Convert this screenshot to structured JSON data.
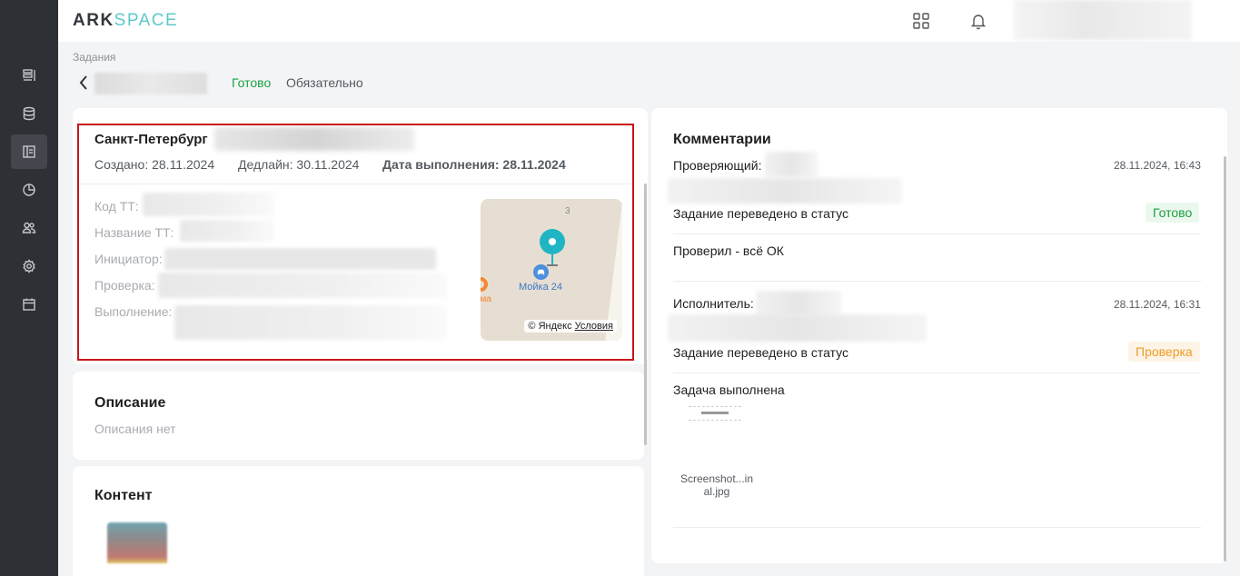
{
  "app": {
    "logo_ark": "ARK",
    "logo_space": "SPACE"
  },
  "sidebar": {
    "items": [
      {
        "icon": "list-icon",
        "active": false
      },
      {
        "icon": "database-icon",
        "active": false
      },
      {
        "icon": "tasks-icon",
        "active": true
      },
      {
        "icon": "chart-pie-icon",
        "active": false
      },
      {
        "icon": "users-icon",
        "active": false
      },
      {
        "icon": "gear-icon",
        "active": false
      },
      {
        "icon": "calendar-icon",
        "active": false
      }
    ]
  },
  "header": {
    "breadcrumb": "Задания",
    "status": "Готово",
    "priority": "Обязательно"
  },
  "task": {
    "city": "Санкт-Петербург",
    "created": "Создано: 28.11.2024",
    "deadline": "Дедлайн: 30.11.2024",
    "completed": "Дата выполнения: 28.11.2024",
    "fields": {
      "code": "Код ТТ:",
      "name": "Название ТТ:",
      "initiator": "Инициатор:",
      "check": "Проверка:",
      "execution": "Выполнение:"
    },
    "map": {
      "building_number": "3",
      "poi_label": "Мойка 24",
      "poi_orange_label": "ома",
      "credit": "© Яндекс",
      "terms": "Условия"
    }
  },
  "description": {
    "title": "Описание",
    "empty": "Описания нет"
  },
  "content": {
    "title": "Контент"
  },
  "comments": {
    "title": "Комментарии",
    "items": [
      {
        "author_label": "Проверяющий:",
        "date": "28.11.2024, 16:43",
        "status_text": "Задание переведено в статус",
        "status_badge": "Готово",
        "message": "Проверил - всё ОК"
      },
      {
        "author_label": "Исполнитель:",
        "date": "28.11.2024, 16:31",
        "status_text": "Задание переведено в статус",
        "status_badge": "Проверка",
        "message": "Задача выполнена",
        "attachment": "Screenshot...in al.jpg"
      }
    ]
  },
  "colors": {
    "accent_green": "#1ca142",
    "accent_orange": "#ef9d24",
    "highlight_red": "#c8151b",
    "sidebar_bg": "#2d3035",
    "logo_teal": "#5ec8c9"
  }
}
